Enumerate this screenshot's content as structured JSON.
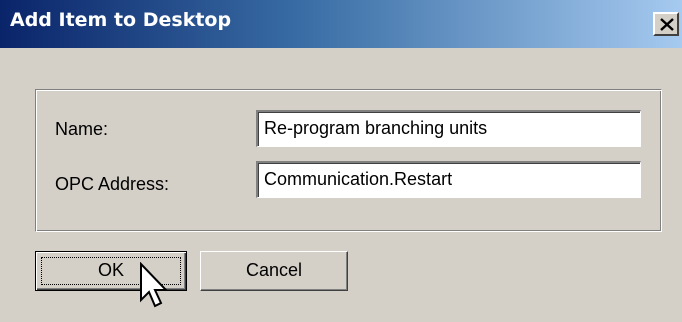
{
  "window": {
    "title": "Add Item to Desktop",
    "close_icon": "close-x-icon"
  },
  "form": {
    "name_label": "Name:",
    "name_value": "Re-program branching units",
    "opc_label": "OPC Address:",
    "opc_value": "Communication.Restart"
  },
  "buttons": {
    "ok_label": "OK",
    "cancel_label": "Cancel"
  },
  "pointer": {
    "icon": "arrow-cursor-icon"
  },
  "colors": {
    "dialog_bg": "#d4d0c8",
    "title_gradient_start": "#0a246a",
    "title_gradient_end": "#a6caf0",
    "title_text": "#ffffff"
  }
}
